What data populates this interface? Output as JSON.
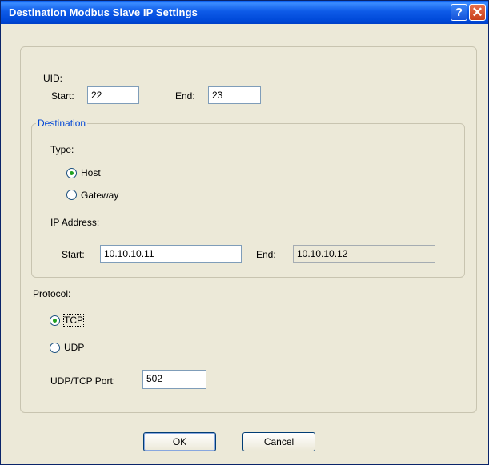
{
  "window": {
    "title": "Destination Modbus Slave IP Settings",
    "help_glyph": "?",
    "close_glyph": "✕"
  },
  "uid": {
    "label": "UID:",
    "start_label": "Start:",
    "start_value": "22",
    "end_label": "End:",
    "end_value": "23"
  },
  "destination": {
    "legend": "Destination",
    "type_label": "Type:",
    "options": [
      {
        "label": "Host",
        "selected": true
      },
      {
        "label": "Gateway",
        "selected": false
      }
    ],
    "ip_label": "IP Address:",
    "start_label": "Start:",
    "start_value": "10.10.10.11",
    "end_label": "End:",
    "end_value": "10.10.10.12"
  },
  "protocol": {
    "label": "Protocol:",
    "options": [
      {
        "label": "TCP",
        "selected": true
      },
      {
        "label": "UDP",
        "selected": false
      }
    ],
    "port_label": "UDP/TCP Port:",
    "port_value": "502"
  },
  "buttons": {
    "ok": "OK",
    "cancel": "Cancel"
  }
}
